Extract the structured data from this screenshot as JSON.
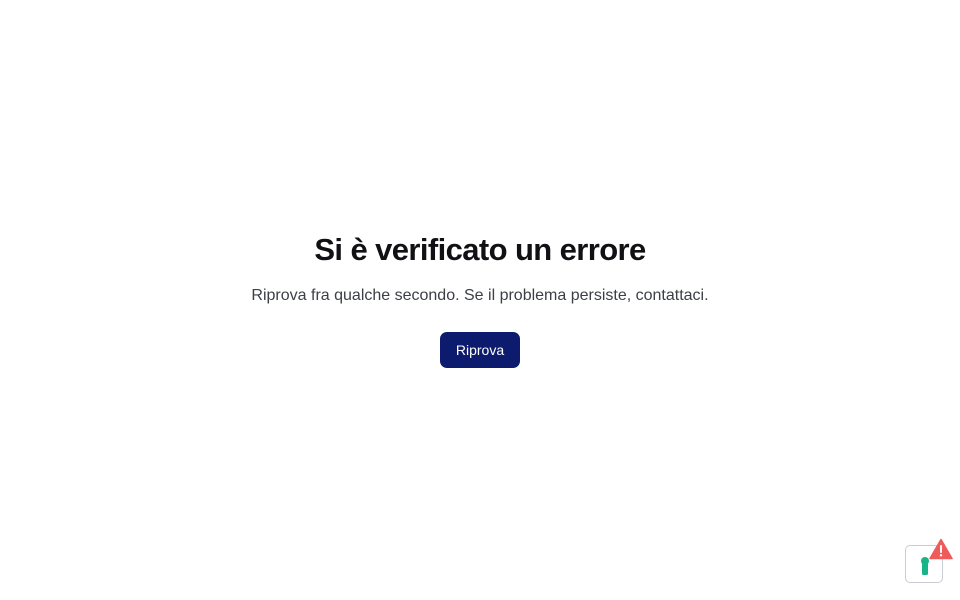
{
  "error": {
    "title": "Si è verificato un errore",
    "message": "Riprova fra qualche secondo. Se il problema persiste, contattaci.",
    "retry_label": "Riprova"
  },
  "widget": {
    "icon": "keyhole-icon",
    "badge_icon": "warning-icon",
    "accent_color": "#19b388",
    "badge_color": "#ef5a5a"
  },
  "colors": {
    "button_bg": "#0d1b6e",
    "title": "#101015",
    "text": "#3c3f46"
  }
}
